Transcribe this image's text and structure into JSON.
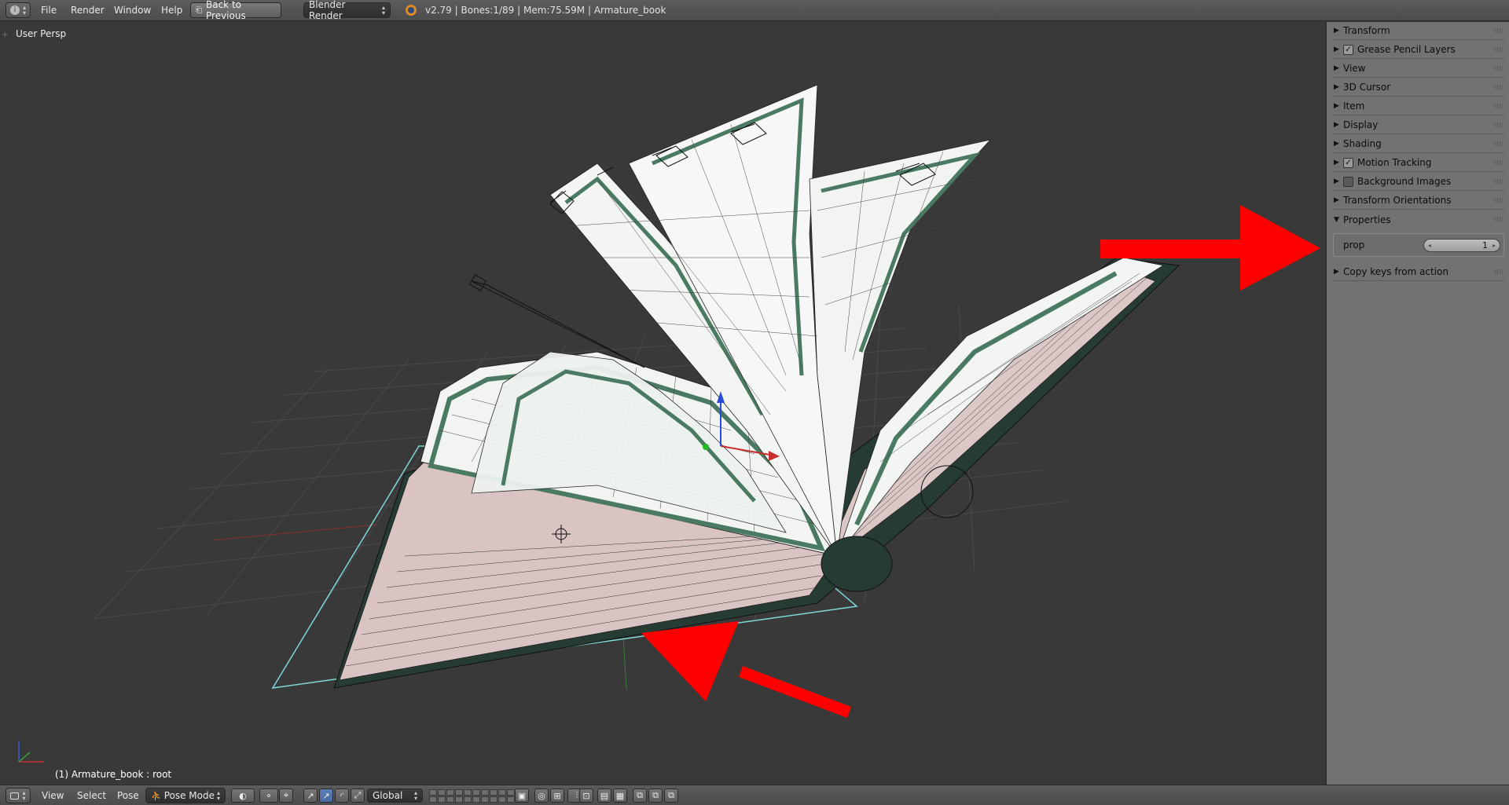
{
  "topbar": {
    "menus": [
      "File",
      "Render",
      "Window",
      "Help"
    ],
    "back_button": "Back to Previous",
    "render_engine": "Blender Render",
    "stats": "v2.79 | Bones:1/89  | Mem:75.59M | Armature_book"
  },
  "viewport": {
    "label": "User Persp",
    "status": "(1) Armature_book : root"
  },
  "sidebar": {
    "panels": [
      {
        "label": "Transform",
        "checkbox": null,
        "expanded": false
      },
      {
        "label": "Grease Pencil Layers",
        "checkbox": true,
        "expanded": false
      },
      {
        "label": "View",
        "checkbox": null,
        "expanded": false
      },
      {
        "label": "3D Cursor",
        "checkbox": null,
        "expanded": false
      },
      {
        "label": "Item",
        "checkbox": null,
        "expanded": false
      },
      {
        "label": "Display",
        "checkbox": null,
        "expanded": false
      },
      {
        "label": "Shading",
        "checkbox": null,
        "expanded": false
      },
      {
        "label": "Motion Tracking",
        "checkbox": true,
        "expanded": false
      },
      {
        "label": "Background Images",
        "checkbox": false,
        "expanded": false
      },
      {
        "label": "Transform Orientations",
        "checkbox": null,
        "expanded": false
      },
      {
        "label": "Properties",
        "checkbox": null,
        "expanded": true
      }
    ],
    "property": {
      "label": "prop",
      "value": "1"
    },
    "extra_panel": "Copy keys from action"
  },
  "bottombar": {
    "menus": [
      "View",
      "Select",
      "Pose"
    ],
    "mode": "Pose Mode",
    "orientation": "Global"
  },
  "colors": {
    "viewport_bg": "#393939",
    "sidebar_bg": "#727272",
    "annotation_arrow": "#ff0000",
    "page_green": "#4a7a62",
    "edge_pink": "#d9c3c3",
    "selection_cyan": "#7fd8d8"
  }
}
